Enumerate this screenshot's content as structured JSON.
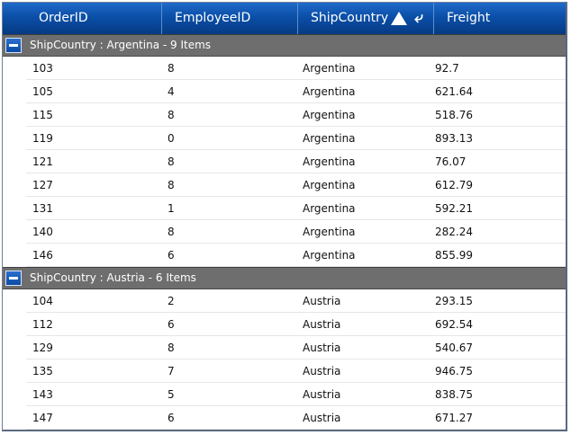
{
  "columns": [
    "OrderID",
    "EmployeeID",
    "ShipCountry",
    "Freight"
  ],
  "sort": {
    "column": "ShipCountry",
    "direction": "ascending",
    "icons": [
      "sort-ascending-icon",
      "drag-arrow-icon"
    ]
  },
  "groups": [
    {
      "label": "ShipCountry : Argentina - 9 Items",
      "rows": [
        [
          "103",
          "8",
          "Argentina",
          "92.7"
        ],
        [
          "105",
          "4",
          "Argentina",
          "621.64"
        ],
        [
          "115",
          "8",
          "Argentina",
          "518.76"
        ],
        [
          "119",
          "0",
          "Argentina",
          "893.13"
        ],
        [
          "121",
          "8",
          "Argentina",
          "76.07"
        ],
        [
          "127",
          "8",
          "Argentina",
          "612.79"
        ],
        [
          "131",
          "1",
          "Argentina",
          "592.21"
        ],
        [
          "140",
          "8",
          "Argentina",
          "282.24"
        ],
        [
          "146",
          "6",
          "Argentina",
          "855.99"
        ]
      ]
    },
    {
      "label": "ShipCountry : Austria - 6 Items",
      "rows": [
        [
          "104",
          "2",
          "Austria",
          "293.15"
        ],
        [
          "112",
          "6",
          "Austria",
          "692.54"
        ],
        [
          "129",
          "8",
          "Austria",
          "540.67"
        ],
        [
          "135",
          "7",
          "Austria",
          "946.75"
        ],
        [
          "143",
          "5",
          "Austria",
          "838.75"
        ],
        [
          "147",
          "6",
          "Austria",
          "671.27"
        ]
      ]
    }
  ],
  "colors": {
    "header": "#0b4fa8",
    "group_bar": "#6e6e6e",
    "toggle": "#1a5cc0"
  }
}
